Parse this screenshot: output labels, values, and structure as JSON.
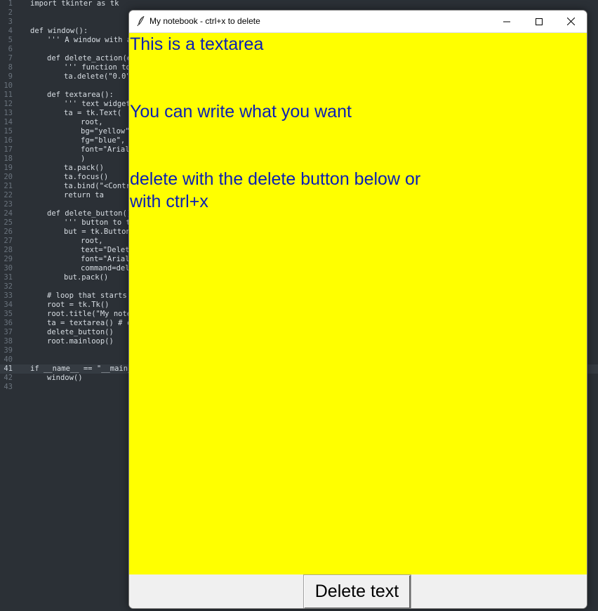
{
  "editor": {
    "current_line": 41,
    "lines": [
      {
        "n": "1",
        "indent": 0,
        "text": "import tkinter as tk"
      },
      {
        "n": "2",
        "indent": 0,
        "text": ""
      },
      {
        "n": "3",
        "indent": 0,
        "text": ""
      },
      {
        "n": "4",
        "indent": 0,
        "text": "def window():"
      },
      {
        "n": "5",
        "indent": 1,
        "text": "''' A window with a"
      },
      {
        "n": "6",
        "indent": 0,
        "text": ""
      },
      {
        "n": "7",
        "indent": 1,
        "text": "def delete_action(e"
      },
      {
        "n": "8",
        "indent": 2,
        "text": "''' function to"
      },
      {
        "n": "9",
        "indent": 2,
        "text": "ta.delete(\"0.0\""
      },
      {
        "n": "10",
        "indent": 0,
        "text": ""
      },
      {
        "n": "11",
        "indent": 1,
        "text": "def textarea():"
      },
      {
        "n": "12",
        "indent": 2,
        "text": "''' text widget"
      },
      {
        "n": "13",
        "indent": 2,
        "text": "ta = tk.Text("
      },
      {
        "n": "14",
        "indent": 3,
        "text": "root,"
      },
      {
        "n": "15",
        "indent": 3,
        "text": "bg=\"yellow\""
      },
      {
        "n": "16",
        "indent": 3,
        "text": "fg=\"blue\","
      },
      {
        "n": "17",
        "indent": 3,
        "text": "font=\"Arial"
      },
      {
        "n": "18",
        "indent": 3,
        "text": ")"
      },
      {
        "n": "19",
        "indent": 2,
        "text": "ta.pack()"
      },
      {
        "n": "20",
        "indent": 2,
        "text": "ta.focus()"
      },
      {
        "n": "21",
        "indent": 2,
        "text": "ta.bind(\"<Contr"
      },
      {
        "n": "22",
        "indent": 2,
        "text": "return ta"
      },
      {
        "n": "23",
        "indent": 0,
        "text": ""
      },
      {
        "n": "24",
        "indent": 1,
        "text": "def delete_button()"
      },
      {
        "n": "25",
        "indent": 2,
        "text": "''' button to t"
      },
      {
        "n": "26",
        "indent": 2,
        "text": "but = tk.Button"
      },
      {
        "n": "27",
        "indent": 3,
        "text": "root,"
      },
      {
        "n": "28",
        "indent": 3,
        "text": "text=\"Delet"
      },
      {
        "n": "29",
        "indent": 3,
        "text": "font=\"Arial"
      },
      {
        "n": "30",
        "indent": 3,
        "text": "command=del"
      },
      {
        "n": "31",
        "indent": 2,
        "text": "but.pack()"
      },
      {
        "n": "32",
        "indent": 0,
        "text": ""
      },
      {
        "n": "33",
        "indent": 1,
        "text": "# loop that starts"
      },
      {
        "n": "34",
        "indent": 1,
        "text": "root = tk.Tk()"
      },
      {
        "n": "35",
        "indent": 1,
        "text": "root.title(\"My note"
      },
      {
        "n": "36",
        "indent": 1,
        "text": "ta = textarea() # c"
      },
      {
        "n": "37",
        "indent": 1,
        "text": "delete_button()"
      },
      {
        "n": "38",
        "indent": 1,
        "text": "root.mainloop()"
      },
      {
        "n": "39",
        "indent": 0,
        "text": ""
      },
      {
        "n": "40",
        "indent": 0,
        "text": ""
      },
      {
        "n": "41",
        "indent": 0,
        "text": "if __name__ == \"__main_"
      },
      {
        "n": "42",
        "indent": 1,
        "text": "window()"
      },
      {
        "n": "43",
        "indent": 0,
        "text": ""
      }
    ]
  },
  "tk_window": {
    "title": "My notebook - ctrl+x to delete",
    "icon": "feather-icon",
    "controls": {
      "minimize": "minimize-icon",
      "maximize": "maximize-icon",
      "close": "close-icon"
    },
    "textarea": {
      "bg": "#ffff00",
      "fg": "#0a1fb4",
      "lines": [
        "This is a textarea",
        "",
        "",
        "You can write what you want",
        "",
        "",
        "delete with the delete button below or",
        "with ctrl+x"
      ]
    },
    "delete_button_label": "Delete text"
  }
}
